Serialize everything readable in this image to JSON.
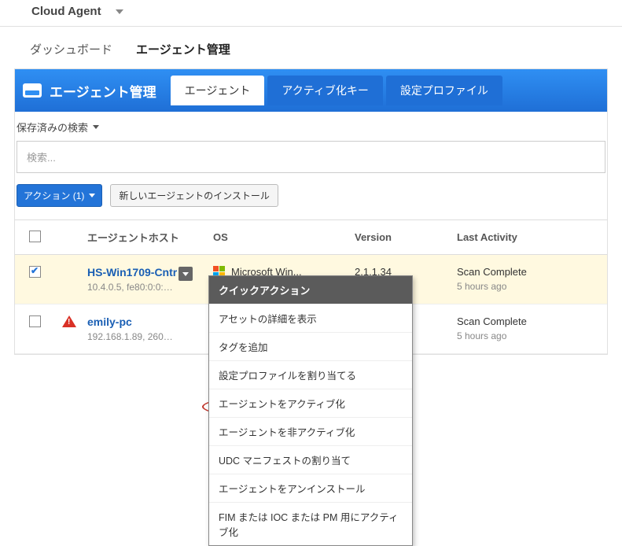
{
  "topbar": {
    "app_name": "Cloud Agent"
  },
  "nav_tabs": {
    "dashboard": "ダッシュボード",
    "agent_mgmt": "エージェント管理"
  },
  "ribbon": {
    "title": "エージェント管理",
    "tabs": {
      "agents": "エージェント",
      "activation": "アクティブ化キー",
      "config": "設定プロファイル"
    }
  },
  "saved_search_label": "保存済みの検索",
  "search_placeholder": "検索...",
  "buttons": {
    "actions": "アクション (1)",
    "install": "新しいエージェントのインストール"
  },
  "columns": {
    "host": "エージェントホスト",
    "os": "OS",
    "version": "Version",
    "activity": "Last Activity"
  },
  "rows": [
    {
      "host": "HS-Win1709-Cntr",
      "sub": "10.4.0.5, fe80:0:0:…",
      "os": "Microsoft Win...",
      "version": "2.1.1.34",
      "activity": "Scan Complete",
      "activity_sub": "5 hours ago",
      "selected": true,
      "icon": "windows"
    },
    {
      "host": "emily-pc",
      "sub": "192.168.1.89, 260…",
      "os": "",
      "version": "",
      "activity": "Scan Complete",
      "activity_sub": "5 hours ago",
      "selected": false,
      "icon": "warn"
    }
  ],
  "menu": {
    "header": "クイックアクション",
    "items": [
      "アセットの詳細を表示",
      "タグを追加",
      "設定プロファイルを割り当てる",
      "エージェントをアクティブ化",
      "エージェントを非アクティブ化",
      "UDC マニフェストの割り当て",
      "エージェントをアンインストール",
      "FIM または IOC または PM 用にアクティブ化"
    ]
  }
}
